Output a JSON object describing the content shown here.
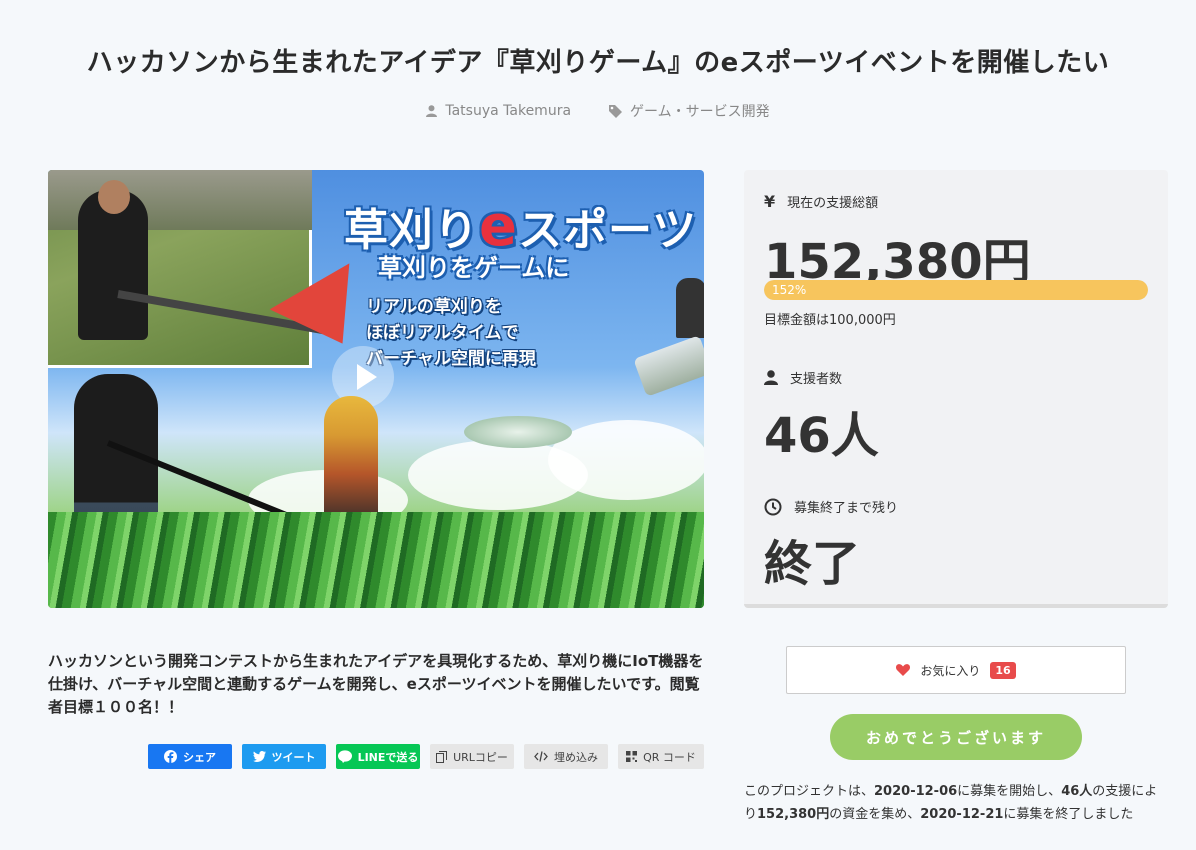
{
  "page": {
    "title": "ハッカソンから生まれたアイデア『草刈りゲーム』のeスポーツイベントを開催したい",
    "author": "Tatsuya Takemura",
    "category": "ゲーム・サービス開発"
  },
  "hero": {
    "logo_pre": "草刈り",
    "logo_e": "e",
    "logo_post": "スポーツ",
    "subtitle": "草刈りをゲームに",
    "desc_line1": "リアルの草刈りを",
    "desc_line2": "ほぼリアルタイムで",
    "desc_line3": "バーチャル空間に再現"
  },
  "stats": {
    "total_label": "現在の支援総額",
    "total_value": "152,380円",
    "progress_label": "152%",
    "progress_fraction": 1.0,
    "goal_text": "目標金額は100,000円",
    "backers_label": "支援者数",
    "backers_value": "46人",
    "remaining_label": "募集終了まで残り",
    "remaining_value": "終了"
  },
  "summary": "ハッカソンという開発コンテストから生まれたアイデアを具現化するため、草刈り機にIoT機器を仕掛け、バーチャル空間と連動するゲームを開発し、eスポーツイベントを開催したいです。閲覧者目標１００名！！",
  "share": {
    "facebook": "シェア",
    "twitter": "ツイート",
    "line": "LINEで送る",
    "url_copy": "URLコピー",
    "embed": "埋め込み",
    "qr": "QR コード"
  },
  "favorite": {
    "label": "お気に入り",
    "count": "16"
  },
  "cta": {
    "label": "おめでとうございます"
  },
  "result": {
    "t1": "このプロジェクトは、",
    "start_date": "2020-12-06",
    "t2": "に募集を開始し、",
    "backers": "46人",
    "t3": "の支援によ",
    "t3b": "り",
    "amount": "152,380円",
    "t4": "の資金を集め、",
    "end_date": "2020-12-21",
    "t5": "に募集を終了しました"
  },
  "colors": {
    "progress": "#f7c55d",
    "cta": "#99cc66",
    "favorite_badge": "#e84b4b",
    "facebook": "#1877f2",
    "twitter": "#1d9bf0",
    "line": "#06c755"
  }
}
